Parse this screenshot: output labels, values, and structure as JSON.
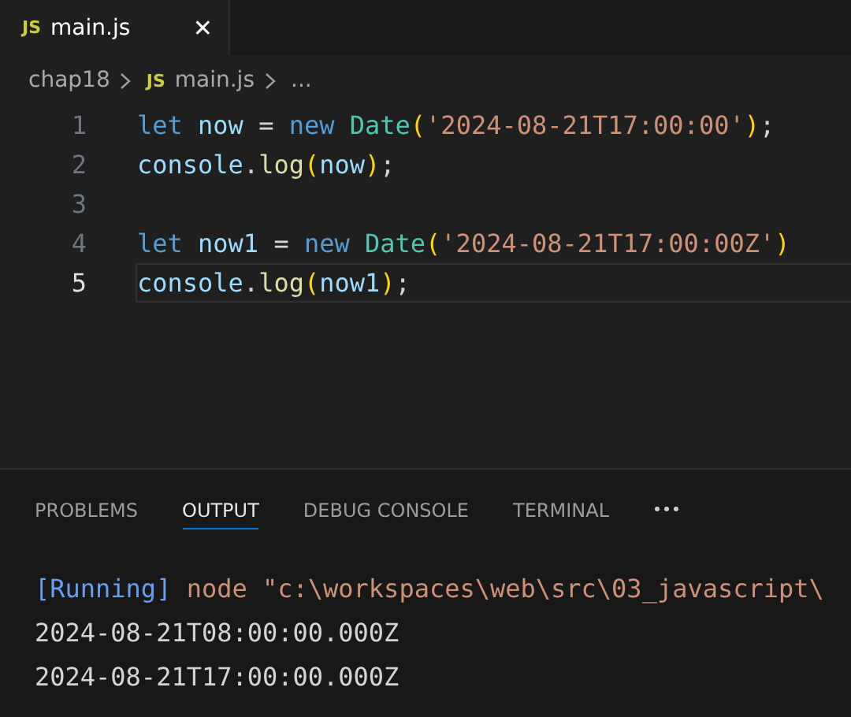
{
  "editor_tabs": [
    {
      "icon_text": "JS",
      "label": "main.js",
      "selected": true,
      "close": "✕"
    }
  ],
  "breadcrumb": {
    "folder": "chap18",
    "icon_text": "JS",
    "file": "main.js",
    "more": "..."
  },
  "code_lines": [
    {
      "number": "1",
      "current": false,
      "tokens": [
        {
          "kind": "keyword",
          "text": "let "
        },
        {
          "kind": "variable",
          "text": "now"
        },
        {
          "kind": "plain",
          "text": " = "
        },
        {
          "kind": "keyword",
          "text": "new "
        },
        {
          "kind": "class",
          "text": "Date"
        },
        {
          "kind": "bracket",
          "text": "("
        },
        {
          "kind": "string",
          "text": "'2024-08-21T17:00:00'"
        },
        {
          "kind": "bracket",
          "text": ")"
        },
        {
          "kind": "plain",
          "text": ";"
        }
      ]
    },
    {
      "number": "2",
      "current": false,
      "tokens": [
        {
          "kind": "variable",
          "text": "console"
        },
        {
          "kind": "plain",
          "text": "."
        },
        {
          "kind": "function",
          "text": "log"
        },
        {
          "kind": "bracket",
          "text": "("
        },
        {
          "kind": "variable",
          "text": "now"
        },
        {
          "kind": "bracket",
          "text": ")"
        },
        {
          "kind": "plain",
          "text": ";"
        }
      ]
    },
    {
      "number": "3",
      "current": false
    },
    {
      "number": "4",
      "current": false,
      "tokens": [
        {
          "kind": "keyword",
          "text": "let "
        },
        {
          "kind": "variable",
          "text": "now1"
        },
        {
          "kind": "plain",
          "text": " = "
        },
        {
          "kind": "keyword",
          "text": "new "
        },
        {
          "kind": "class",
          "text": "Date"
        },
        {
          "kind": "bracket",
          "text": "("
        },
        {
          "kind": "string",
          "text": "'2024-08-21T17:00:00Z'"
        },
        {
          "kind": "bracket",
          "text": ")"
        }
      ]
    },
    {
      "number": "5",
      "current": true,
      "tokens": [
        {
          "kind": "variable",
          "text": "console"
        },
        {
          "kind": "plain",
          "text": "."
        },
        {
          "kind": "function",
          "text": "log"
        },
        {
          "kind": "bracket",
          "text": "("
        },
        {
          "kind": "variable",
          "text": "now1"
        },
        {
          "kind": "bracket",
          "text": ")"
        },
        {
          "kind": "plain",
          "text": ";"
        }
      ]
    }
  ],
  "panel_tabs": [
    {
      "label": "PROBLEMS",
      "selected": false
    },
    {
      "label": "OUTPUT",
      "selected": true
    },
    {
      "label": "DEBUG CONSOLE",
      "selected": false
    },
    {
      "label": "TERMINAL",
      "selected": false
    }
  ],
  "output_lines": [
    {
      "tokens": [
        {
          "kind": "status",
          "text": "[Running] "
        },
        {
          "kind": "command",
          "text": "node \"c:\\workspaces\\web\\src\\03_javascript\\"
        }
      ]
    },
    {
      "tokens": [
        {
          "kind": "plain",
          "text": "2024-08-21T08:00:00.000Z"
        }
      ]
    },
    {
      "tokens": [
        {
          "kind": "plain",
          "text": "2024-08-21T17:00:00.000Z"
        }
      ]
    }
  ]
}
